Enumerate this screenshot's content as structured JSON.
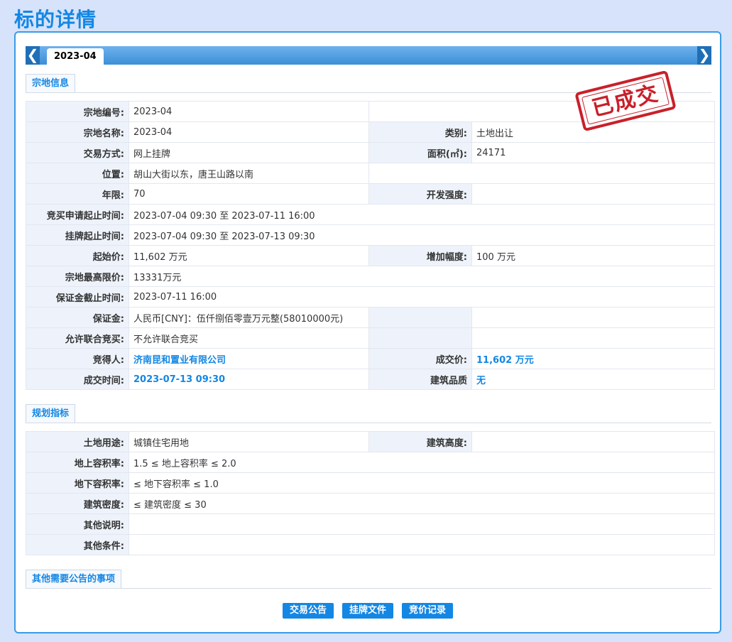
{
  "page_title": "标的详情",
  "tabbar": {
    "active_tab": "2023-04",
    "prev_arrow": "❮",
    "next_arrow": "❯"
  },
  "stamp": "已成交",
  "sections": {
    "land_info": "宗地信息",
    "planning": "规划指标",
    "other": "其他需要公告的事项"
  },
  "land_info": {
    "parcel_no": {
      "label": "宗地编号:",
      "value": "2023-04"
    },
    "parcel_name": {
      "label": "宗地名称:",
      "value": "2023-04"
    },
    "category": {
      "label": "类别:",
      "value": "土地出让"
    },
    "trade_method": {
      "label": "交易方式:",
      "value": "网上挂牌"
    },
    "area": {
      "label": "面积(㎡):",
      "value": "24171"
    },
    "location": {
      "label": "位置:",
      "value": "胡山大街以东，唐王山路以南"
    },
    "term": {
      "label": "年限:",
      "value": "70"
    },
    "dev_intensity": {
      "label": "开发强度:",
      "value": ""
    },
    "bid_apply_period": {
      "label": "竞买申请起止时间:",
      "value": "2023-07-04 09:30 至 2023-07-11 16:00"
    },
    "listing_period": {
      "label": "挂牌起止时间:",
      "value": "2023-07-04 09:30 至 2023-07-13 09:30"
    },
    "start_price": {
      "label": "起始价:",
      "value": "11,602 万元"
    },
    "increment": {
      "label": "增加幅度:",
      "value": "100 万元"
    },
    "max_price": {
      "label": "宗地最高限价:",
      "value": "13331万元"
    },
    "deposit_deadline": {
      "label": "保证金截止时间:",
      "value": "2023-07-11 16:00"
    },
    "deposit": {
      "label": "保证金:",
      "value": "人民币[CNY]：伍仟捌佰零壹万元整(58010000元)"
    },
    "joint_bid": {
      "label": "允许联合竞买:",
      "value": "不允许联合竞买"
    },
    "winner": {
      "label": "竞得人:",
      "value": "济南昆和置业有限公司"
    },
    "deal_price": {
      "label": "成交价:",
      "value": "11,602 万元"
    },
    "deal_time": {
      "label": "成交时间:",
      "value": "2023-07-13 09:30"
    },
    "building_quality": {
      "label": "建筑品质",
      "value": "无"
    }
  },
  "planning": {
    "land_use": {
      "label": "土地用途:",
      "value": "城镇住宅用地"
    },
    "building_height": {
      "label": "建筑高度:",
      "value": ""
    },
    "far_above": {
      "label": "地上容积率:",
      "value": "1.5 ≤ 地上容积率 ≤ 2.0"
    },
    "far_below": {
      "label": "地下容积率:",
      "value": "≤ 地下容积率 ≤ 1.0"
    },
    "building_density": {
      "label": "建筑密度:",
      "value": "≤ 建筑密度 ≤ 30"
    },
    "other_notes": {
      "label": "其他说明:",
      "value": ""
    },
    "other_conditions": {
      "label": "其他条件:",
      "value": ""
    }
  },
  "buttons": {
    "announcement": "交易公告",
    "listing_docs": "挂牌文件",
    "bid_records": "竞价记录"
  },
  "colors": {
    "accent": "#1487e4",
    "stamp_red": "#c8202a",
    "background": "#d6e3fa"
  }
}
